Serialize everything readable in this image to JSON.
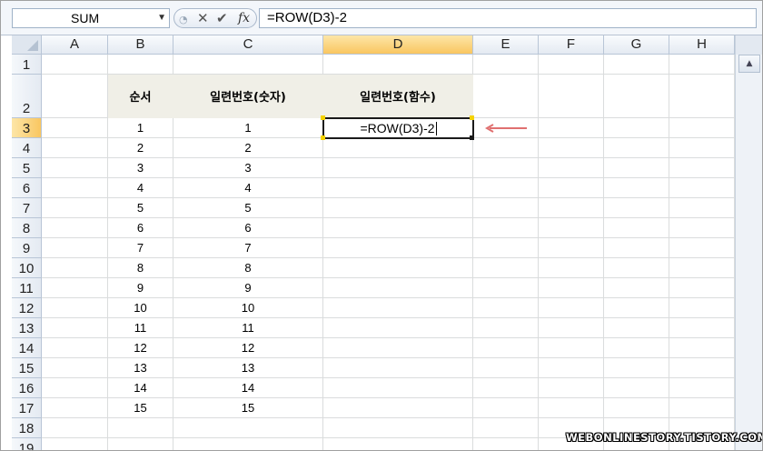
{
  "formula_bar": {
    "name_box": "SUM",
    "formula": "=ROW(D3)-2"
  },
  "columns": [
    {
      "key": "A",
      "label": "A"
    },
    {
      "key": "B",
      "label": "B"
    },
    {
      "key": "C",
      "label": "C"
    },
    {
      "key": "D",
      "label": "D"
    },
    {
      "key": "E",
      "label": "E"
    },
    {
      "key": "F",
      "label": "F"
    },
    {
      "key": "G",
      "label": "G"
    },
    {
      "key": "H",
      "label": "H"
    }
  ],
  "rows": [
    "1",
    "2",
    "3",
    "4",
    "5",
    "6",
    "7",
    "8",
    "9",
    "10",
    "11",
    "12",
    "13",
    "14",
    "15",
    "16",
    "17",
    "18",
    "19"
  ],
  "headers": {
    "B2": "순서",
    "C2": "일련번호(숫자)",
    "D2": "일련번호(함수)"
  },
  "sequence": [
    "1",
    "2",
    "3",
    "4",
    "5",
    "6",
    "7",
    "8",
    "9",
    "10",
    "11",
    "12",
    "13",
    "14",
    "15"
  ],
  "serial_numbers": [
    "1",
    "2",
    "3",
    "4",
    "5",
    "6",
    "7",
    "8",
    "9",
    "10",
    "11",
    "12",
    "13",
    "14",
    "15"
  ],
  "active_cell": {
    "ref": "D3",
    "editing_text": "=ROW(D3)-2"
  },
  "colors": {
    "active_header": "#f9c660",
    "header_band": "#f0efe7",
    "arrow": "#e07070"
  },
  "watermark": "WEBONLINESTORY.TISTORY.COM"
}
